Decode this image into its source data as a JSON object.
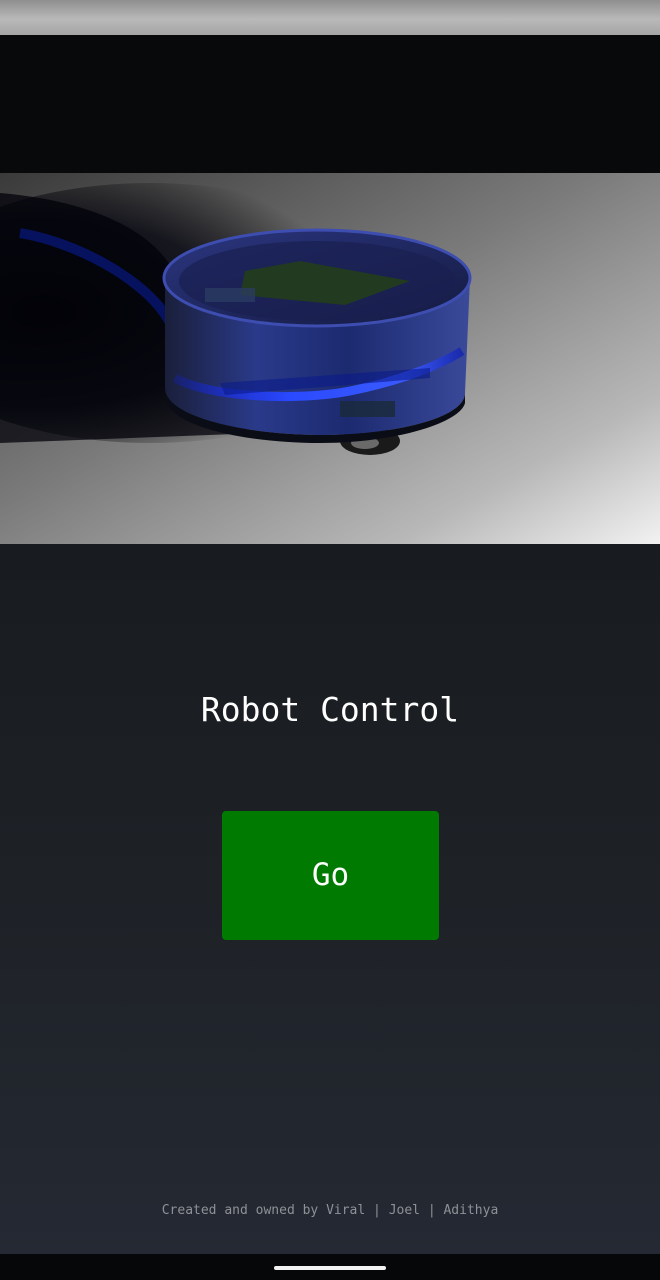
{
  "page": {
    "title": "Robot Control",
    "go_button_label": "Go",
    "footer_text": "Created and owned by Viral | Joel | Adithya"
  },
  "colors": {
    "background": "#1e2227",
    "button": "#017a01",
    "title_text": "#ffffff",
    "footer_text": "#8e9196"
  },
  "icons": {
    "hero": "robot-render-image"
  }
}
